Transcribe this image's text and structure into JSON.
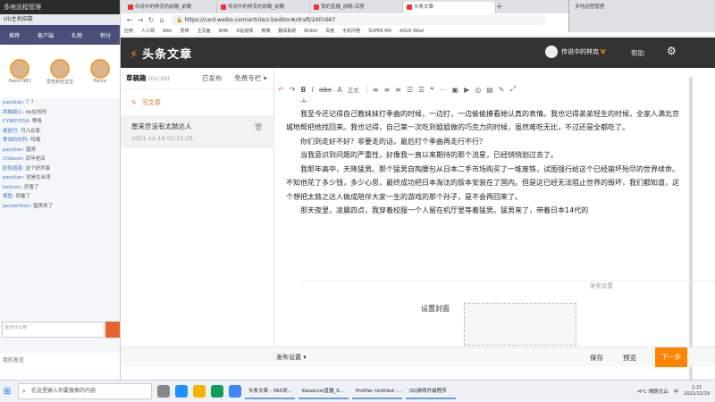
{
  "left_app": {
    "title": "多地远程管理",
    "subtitle": "UU主机招募",
    "nav": [
      "推荐",
      "客户端",
      "礼物",
      "积分"
    ],
    "avatars": [
      {
        "name": "Kazo7982"
      },
      {
        "name": "爱吃粉丝宝宝"
      },
      {
        "name": "Pocca"
      }
    ],
    "chat": [
      {
        "user": "parsitan",
        "text": "？？"
      },
      {
        "user": "西柚甜心",
        "text": "bb在线吗"
      },
      {
        "user": "CYNDY55A",
        "text": "等咯"
      },
      {
        "user": "是欧巴",
        "text": "可儿在家"
      },
      {
        "user": "季海的炸药",
        "text": "呜哦"
      },
      {
        "user": "parsitan",
        "text": "猛男"
      },
      {
        "user": "Chibosh",
        "text": "百年老店"
      },
      {
        "user": "欧阳酒香",
        "text": "这个好厉害"
      },
      {
        "user": "parsitan",
        "text": "这是在台湾"
      },
      {
        "user": "kotsuro",
        "text": "厉害了"
      },
      {
        "user": "摸鱼",
        "text": "别催了"
      },
      {
        "user": "JacobsYoon",
        "text": "猛男来了"
      }
    ],
    "input_placeholder": "说点什么吧",
    "bottom_text": "我的发言"
  },
  "browser": {
    "tabs": [
      {
        "label": "传说中的林克的前瞻_前瞻"
      },
      {
        "label": "传说中的林克的前瞻_前瞻"
      },
      {
        "label": "我的直播_前瞻-百度"
      },
      {
        "label": "头条文章"
      }
    ],
    "new_tab": "+",
    "window_controls": {
      "min": "—",
      "max": "☐",
      "close": "✕"
    },
    "url": "https://card.weibo.com/article/v3/editor#/draft/2401667",
    "bookmarks": [
      "应用",
      "人人网",
      "Wiki",
      "原神",
      "主页面",
      "NHK",
      "D站视频",
      "微博",
      "翻译系统",
      "Bilibili",
      "百度",
      "手机问卷",
      "SUPER MA",
      "ASUS Wkel"
    ]
  },
  "weibo": {
    "logo": "头条文章",
    "username": "传说中的林克",
    "user_badge": "V",
    "help": "帮助",
    "side_tabs": {
      "drafts": "草稿箱",
      "drafts_count": "(01/30)",
      "published": "已发布",
      "paid": "免费专栏 ▾"
    },
    "write_new": "写文章",
    "draft_item": {
      "title": "愿来世没有太鼓达人",
      "date": "2021-12-19 01:21:25"
    },
    "toolbar": {
      "font_select": "正文",
      "items": [
        "↶",
        "↷",
        "B",
        "I",
        "abc",
        "A",
        "≡",
        "≡",
        "≡",
        "≡",
        "≡",
        "❝",
        "⋯",
        "▣",
        "▣",
        "◎",
        "▤",
        "✎",
        "⤢"
      ]
    },
    "editor_paragraphs": [
      "我至今还记得自己教妹妹打季曲的时候，一边打，一边偷偷摸看她认真的表情。我也记得弟弟轻生的时候，全家人满北京城地帮把他找回来。我也记得，自己第一次吃到姐姐做的巧克力的时候，虽然难吃无比，不过还是全都吃了。",
      "你们到走好不好？非要走的话，最后打个季曲再走行不行？",
      "当我意识到问题的严重性，好像我一直以来期待的那个流星，已经悄悄划过去了。",
      "我那年高中，天降猛男。那个猛男自掏腰包从日本二手市场购买了一堆废铁，试图强行给这个已经崩坏殆尽的世界续命。不知他花了多少钱，多少心思，最终成功把日本淘汰的版本安装在了国内。但是这已经无法阻止世界的毁坏，我们都知道，这个想把太鼓之达人做成陪伴大家一生的游戏的那个孙子，是不会再回来了。",
      "那天夜里，凌晨四点，我穿着校服一个人留在机厅里等着猛男。猛男来了，带着日本14代的"
    ],
    "publish_settings": "发布设置",
    "cover_label": "设置封面",
    "bottom": {
      "settings": "发布设置 ▾",
      "save": "保存",
      "preview": "预览",
      "next": "下一步"
    }
  },
  "right_window": {
    "title": "多地远程管理"
  },
  "taskbar": {
    "search_placeholder": "在这里输入你要搜索的内容",
    "apps": [
      {
        "label": "头条文章 - 360浏..."
      },
      {
        "label": "KaseLink直播_S..."
      },
      {
        "label": "Profiler Untitled -..."
      },
      {
        "label": "QQ游戏升级程序"
      }
    ],
    "weather": "-4°C 晴朗无云",
    "ime": "中",
    "time": "1:21",
    "date": "2021/12/19"
  },
  "colors": {
    "accent": "#ff8200",
    "header_bg": "#333333"
  }
}
